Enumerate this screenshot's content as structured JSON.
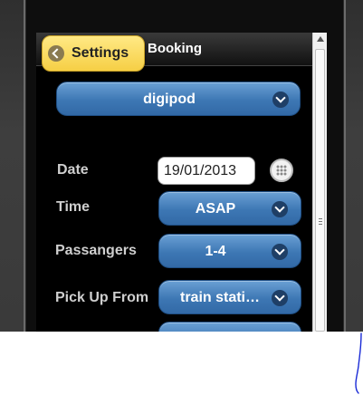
{
  "header": {
    "title": "Booking",
    "back_label": "Settings"
  },
  "form": {
    "vendor": {
      "value": "digipod"
    },
    "date": {
      "label": "Date",
      "value": "19/01/2013"
    },
    "time": {
      "label": "Time",
      "value": "ASAP"
    },
    "passengers": {
      "label": "Passangers",
      "value": "1-4"
    },
    "pickup": {
      "label": "Pick Up From",
      "value": "train stati…"
    }
  },
  "colors": {
    "accent_yellow": "#f6cf45",
    "select_blue": "#3d77b4",
    "background": "#000000",
    "annotation_ink": "#1a2bd6"
  },
  "icons": {
    "back": "chevron-left-circle-icon",
    "dropdown": "chevron-down-circle-icon",
    "calendar": "calendar-grid-icon"
  }
}
